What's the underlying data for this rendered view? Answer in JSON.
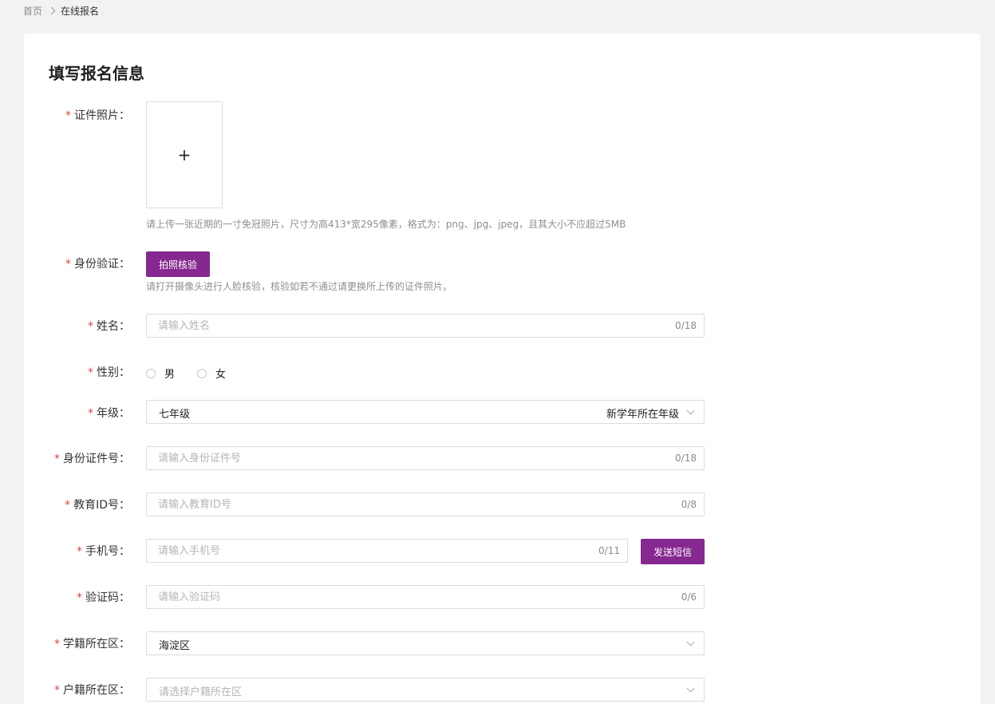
{
  "breadcrumb": {
    "home": "首页",
    "current": "在线报名"
  },
  "title": "填写报名信息",
  "photo": {
    "label": "证件照片：",
    "hint": "请上传一张近期的一寸免冠照片，尺寸为高413*宽295像素，格式为：png、jpg、jpeg，且其大小不应超过5MB"
  },
  "identity": {
    "label": "身份验证：",
    "button": "拍照核验",
    "hint": "请打开摄像头进行人脸核验，核验如若不通过请更换所上传的证件照片。"
  },
  "name": {
    "label": "姓名：",
    "placeholder": "请输入姓名",
    "counter": "0/18"
  },
  "gender": {
    "label": "性别：",
    "options": [
      "男",
      "女"
    ]
  },
  "grade": {
    "label": "年级：",
    "value": "七年级",
    "note": "新学年所在年级"
  },
  "id_number": {
    "label": "身份证件号：",
    "placeholder": "请输入身份证件号",
    "counter": "0/18"
  },
  "edu_id": {
    "label": "教育ID号：",
    "placeholder": "请输入教育ID号",
    "counter": "0/8"
  },
  "phone": {
    "label": "手机号：",
    "placeholder": "请输入手机号",
    "counter": "0/11",
    "send_button": "发送短信"
  },
  "code": {
    "label": "验证码：",
    "placeholder": "请输入验证码",
    "counter": "0/6"
  },
  "school_district": {
    "label": "学籍所在区：",
    "value": "海淀区"
  },
  "household_district": {
    "label": "户籍所在区：",
    "placeholder": "请选择户籍所在区"
  },
  "colors": {
    "accent": "#85288f",
    "required": "#e04444"
  }
}
